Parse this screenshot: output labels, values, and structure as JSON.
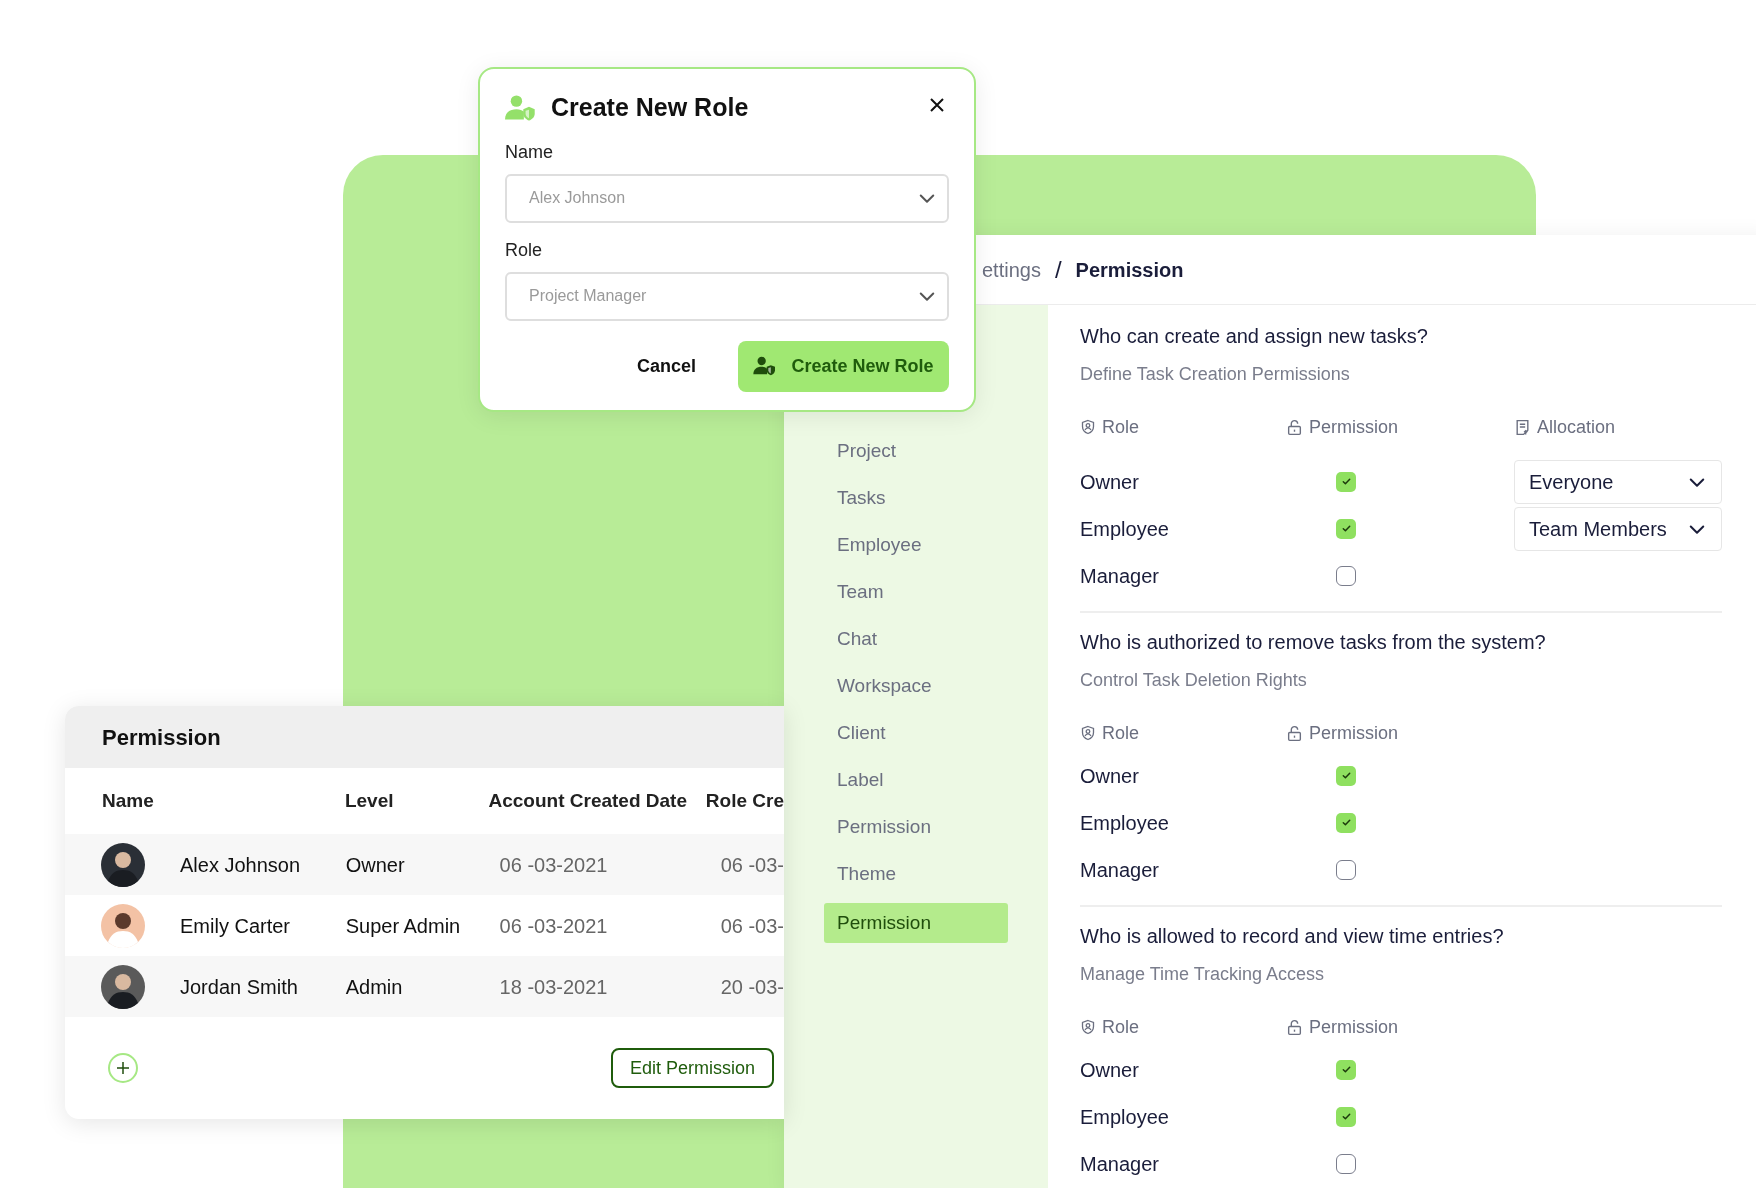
{
  "dialog": {
    "title": "Create New Role",
    "fields": [
      {
        "label": "Name",
        "placeholder": "Alex Johnson"
      },
      {
        "label": "Role",
        "placeholder": "Project Manager"
      }
    ],
    "buttons": [
      {
        "label": "Cancel",
        "kind": "text"
      },
      {
        "label": "Create New Role",
        "kind": "primary"
      }
    ]
  },
  "settings": {
    "breadcrumb": [
      "ettings",
      "Permission"
    ],
    "breadcrumb_separator": "/",
    "sidebar": [
      {
        "label": "Project",
        "selected": false
      },
      {
        "label": "Tasks",
        "selected": false
      },
      {
        "label": "Employee",
        "selected": false
      },
      {
        "label": "Team",
        "selected": false
      },
      {
        "label": "Chat",
        "selected": false
      },
      {
        "label": "Workspace",
        "selected": false
      },
      {
        "label": "Client",
        "selected": false
      },
      {
        "label": "Label",
        "selected": false
      },
      {
        "label": "Permission",
        "selected": false
      },
      {
        "label": "Theme",
        "selected": false
      },
      {
        "label": "Permission",
        "selected": true
      }
    ],
    "sections": [
      {
        "question": "Who can create and assign new tasks?",
        "subtitle": "Define Task Creation Permissions",
        "columns": [
          "Role",
          "Permission",
          "Allocation"
        ],
        "rows": [
          {
            "role": "Owner",
            "checked": true,
            "allocation": "Everyone"
          },
          {
            "role": "Employee",
            "checked": true,
            "allocation": "Team Members"
          },
          {
            "role": "Manager",
            "checked": false
          }
        ]
      },
      {
        "question": "Who is authorized to remove tasks from the system?",
        "subtitle": "Control Task Deletion Rights",
        "columns": [
          "Role",
          "Permission"
        ],
        "rows": [
          {
            "role": "Owner",
            "checked": true
          },
          {
            "role": "Employee",
            "checked": true
          },
          {
            "role": "Manager",
            "checked": false
          }
        ]
      },
      {
        "question": "Who is allowed to record and view time entries?",
        "subtitle": "Manage Time Tracking Access",
        "columns": [
          "Role",
          "Permission"
        ],
        "rows": [
          {
            "role": "Owner",
            "checked": true
          },
          {
            "role": "Employee",
            "checked": true
          },
          {
            "role": "Manager",
            "checked": false
          }
        ]
      }
    ]
  },
  "permission_table": {
    "title": "Permission",
    "columns": [
      "Name",
      "Level",
      "Account Created Date",
      "Role Cre"
    ],
    "rows": [
      {
        "name": "Alex Johnson",
        "level": "Owner",
        "account_created": "06 -03-2021",
        "column_4": "06 -03-"
      },
      {
        "name": "Emily Carter",
        "level": "Super Admin",
        "account_created": "06 -03-2021",
        "column_4": "06 -03-"
      },
      {
        "name": "Jordan Smith",
        "level": "Admin",
        "account_created": "18 -03-2021",
        "column_4": "20 -03-"
      }
    ],
    "button": "Edit Permission"
  }
}
